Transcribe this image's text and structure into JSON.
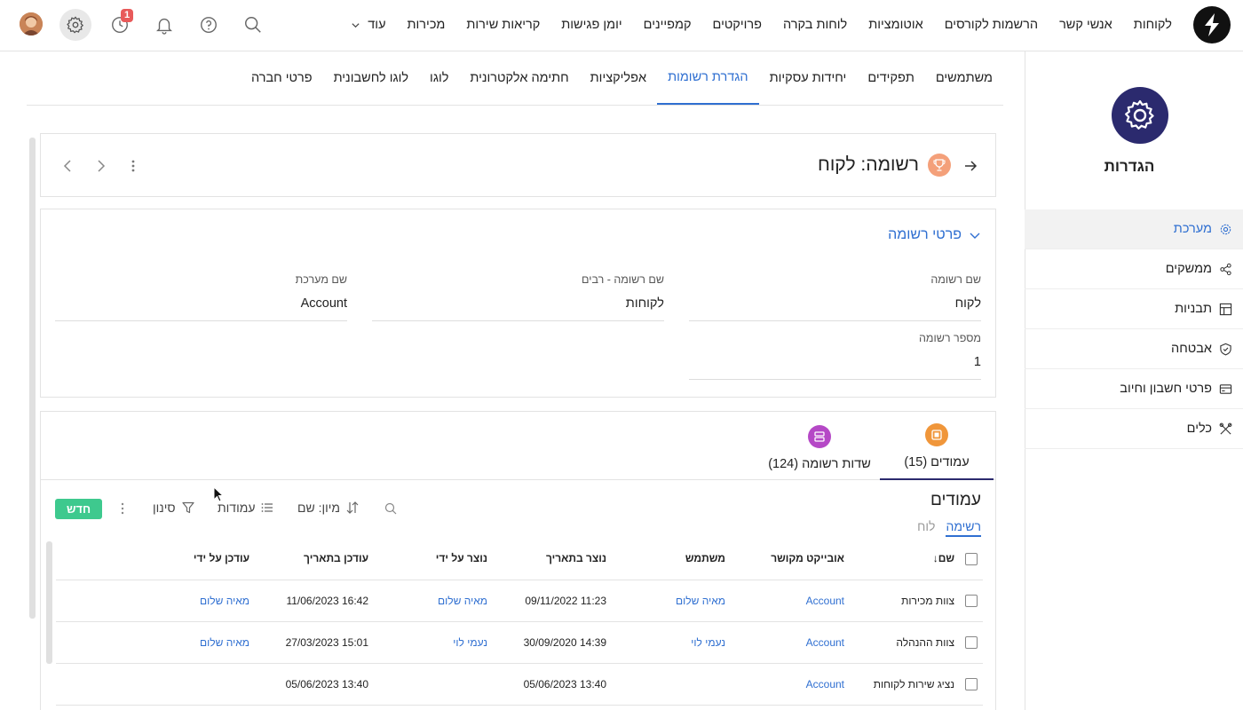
{
  "topbar": {
    "nav": [
      "לקוחות",
      "אנשי קשר",
      "הרשמות לקורסים",
      "אוטומציות",
      "לוחות בקרה",
      "פרויקטים",
      "קמפיינים",
      "יומן פגישות",
      "קריאות שירות",
      "מכירות"
    ],
    "more_label": "עוד",
    "history_badge": "1"
  },
  "sidebar": {
    "title": "הגדרות",
    "items": [
      {
        "label": "מערכת",
        "icon": "gear-icon",
        "active": true
      },
      {
        "label": "ממשקים",
        "icon": "share-icon",
        "active": false
      },
      {
        "label": "תבניות",
        "icon": "layout-icon",
        "active": false
      },
      {
        "label": "אבטחה",
        "icon": "shield-icon",
        "active": false
      },
      {
        "label": "פרטי חשבון וחיוב",
        "icon": "credit-card-icon",
        "active": false
      },
      {
        "label": "כלים",
        "icon": "tools-icon",
        "active": false
      }
    ]
  },
  "subtabs": [
    {
      "label": "משתמשים",
      "active": false
    },
    {
      "label": "תפקידים",
      "active": false
    },
    {
      "label": "יחידות עסקיות",
      "active": false
    },
    {
      "label": "הגדרת רשומות",
      "active": true
    },
    {
      "label": "אפליקציות",
      "active": false
    },
    {
      "label": "חתימה אלקטרונית",
      "active": false
    },
    {
      "label": "לוגו",
      "active": false
    },
    {
      "label": "לוגו לחשבונית",
      "active": false
    },
    {
      "label": "פרטי חברה",
      "active": false
    }
  ],
  "record": {
    "title": "רשומה: לקוח"
  },
  "details": {
    "section_title": "פרטי רשומה",
    "fields": {
      "record_name": {
        "label": "שם רשומה",
        "value": "לקוח"
      },
      "record_plural": {
        "label": "שם רשומה - רבים",
        "value": "לקוחות"
      },
      "system_name": {
        "label": "שם מערכת",
        "value": "Account"
      },
      "record_number": {
        "label": "מספר רשומה",
        "value": "1"
      }
    }
  },
  "list": {
    "tabs": {
      "columns": "עמודים (15)",
      "fields": "שדות רשומה (124)"
    },
    "title": "עמודים",
    "views": {
      "list": "רשימה",
      "board": "לוח"
    },
    "toolbar": {
      "sort": "מיון: שם",
      "columns": "עמודות",
      "filter": "סינון",
      "new": "חדש"
    },
    "headers": {
      "name": "שם",
      "related_object": "אובייקט מקושר",
      "user": "משתמש",
      "created_date": "נוצר בתאריך",
      "created_by": "נוצר על ידי",
      "updated_date": "עודכן בתאריך",
      "updated_by": "עודכן על ידי"
    },
    "rows": [
      {
        "name": "צוות מכירות",
        "related_object": "Account",
        "user": "מאיה שלום",
        "created_date": "11:23 09/11/2022",
        "created_by": "מאיה שלום",
        "updated_date": "16:42 11/06/2023",
        "updated_by": "מאיה שלום"
      },
      {
        "name": "צוות ההנהלה",
        "related_object": "Account",
        "user": "נעמי לוי",
        "created_date": "14:39 30/09/2020",
        "created_by": "נעמי לוי",
        "updated_date": "15:01 27/03/2023",
        "updated_by": "מאיה שלום"
      },
      {
        "name": "נציג שירות לקוחות",
        "related_object": "Account",
        "user": "",
        "created_date": "13:40 05/06/2023",
        "created_by": "",
        "updated_date": "13:40 05/06/2023",
        "updated_by": ""
      }
    ]
  },
  "colors": {
    "accent": "#2f6fd1",
    "brand_dark": "#2b2a6e",
    "new_button": "#3ec98e",
    "badge": "#e85a5a",
    "trophy": "#f4a07a",
    "columns_tab_icon": "#f0963a",
    "fields_tab_icon": "#b548c6"
  }
}
